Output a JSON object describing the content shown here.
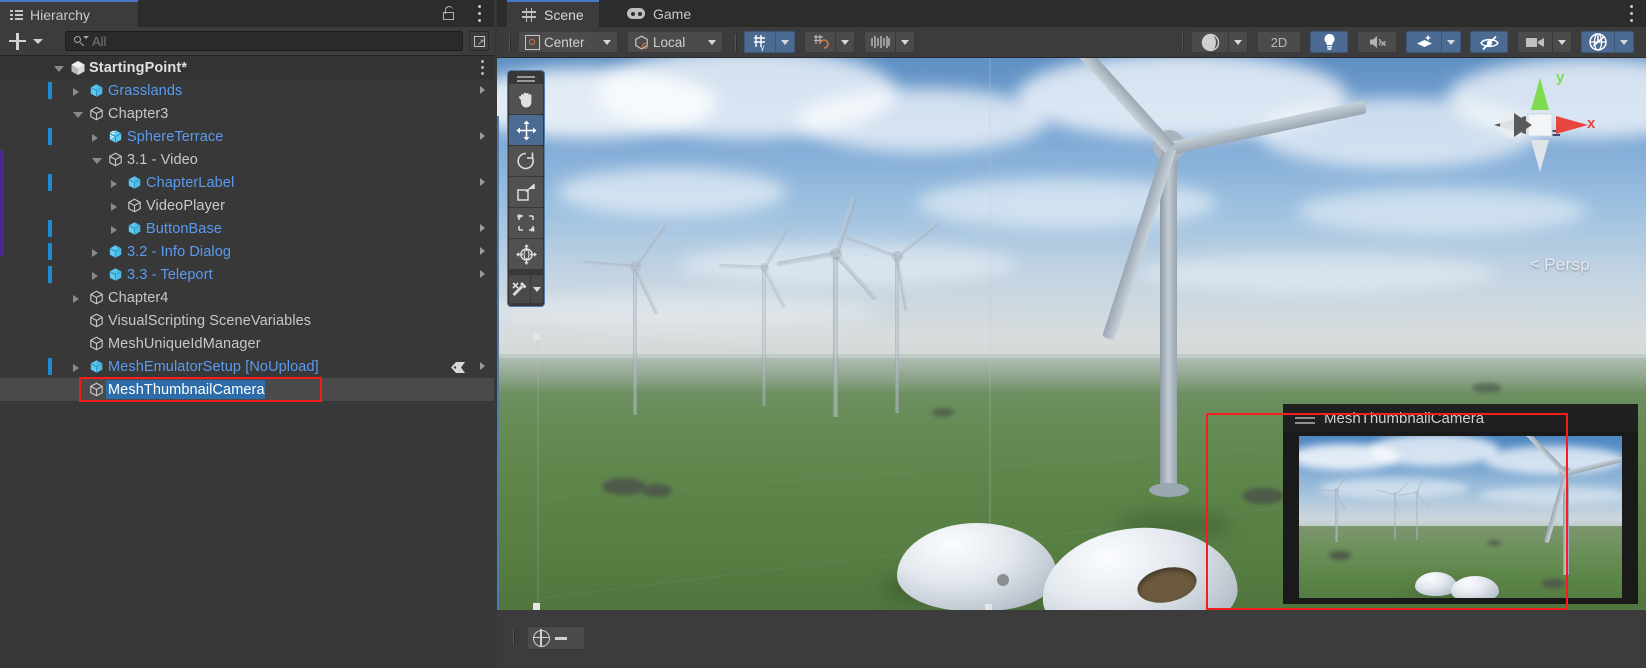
{
  "hierarchy": {
    "tab_label": "Hierarchy",
    "tab_icon": "hierarchy-list-icon",
    "lock_icon": "lock-open-icon",
    "menu_icon": "kebab-menu-icon",
    "create_label": "+",
    "search": {
      "placeholder": "All",
      "icon": "search-icon",
      "value": ""
    },
    "persist_icon": "save-search-icon",
    "tree": [
      {
        "label": "StartingPoint*",
        "depth": 0,
        "icon": "unity-scene-icon",
        "color": "white",
        "bold": true,
        "expanded": true,
        "prefab_bar": false,
        "chevron": false,
        "kebab": true
      },
      {
        "label": "Grasslands",
        "depth": 1,
        "icon": "prefab-cube-icon",
        "color": "blue",
        "bold": false,
        "expanded": false,
        "prefab_bar": true,
        "chevron": true,
        "kebab": false
      },
      {
        "label": "Chapter3",
        "depth": 1,
        "icon": "gameobject-cube-icon",
        "color": "white",
        "bold": false,
        "expanded": true,
        "prefab_bar": false,
        "chevron": false,
        "kebab": false
      },
      {
        "label": "SphereTerrace",
        "depth": 2,
        "icon": "prefab-variant-icon",
        "color": "blue",
        "bold": false,
        "expanded": false,
        "prefab_bar": true,
        "chevron": true,
        "kebab": false
      },
      {
        "label": "3.1 - Video",
        "depth": 2,
        "icon": "gameobject-cube-icon",
        "color": "white",
        "bold": false,
        "expanded": true,
        "prefab_bar": false,
        "chevron": false,
        "kebab": false
      },
      {
        "label": "ChapterLabel",
        "depth": 3,
        "icon": "prefab-cube-icon",
        "color": "blue",
        "bold": false,
        "expanded": false,
        "prefab_bar": true,
        "chevron": true,
        "kebab": false
      },
      {
        "label": "VideoPlayer",
        "depth": 3,
        "icon": "gameobject-cube-icon",
        "color": "white",
        "bold": false,
        "expanded": false,
        "prefab_bar": false,
        "chevron": false,
        "kebab": false
      },
      {
        "label": "ButtonBase",
        "depth": 3,
        "icon": "prefab-cube-icon",
        "color": "blue",
        "bold": false,
        "expanded": false,
        "prefab_bar": true,
        "chevron": true,
        "kebab": false
      },
      {
        "label": "3.2 - Info Dialog",
        "depth": 2,
        "icon": "prefab-cube-icon",
        "color": "blue",
        "bold": false,
        "expanded": false,
        "prefab_bar": true,
        "chevron": true,
        "kebab": false
      },
      {
        "label": "3.3 - Teleport",
        "depth": 2,
        "icon": "prefab-cube-icon",
        "color": "blue",
        "bold": false,
        "expanded": false,
        "prefab_bar": true,
        "chevron": true,
        "kebab": false
      },
      {
        "label": "Chapter4",
        "depth": 1,
        "icon": "gameobject-cube-icon",
        "color": "white",
        "bold": false,
        "expanded": false,
        "prefab_bar": false,
        "chevron": false,
        "kebab": false
      },
      {
        "label": "VisualScripting SceneVariables",
        "depth": 1,
        "icon": "gameobject-cube-icon",
        "color": "white",
        "bold": false,
        "expanded": null,
        "prefab_bar": false,
        "chevron": false,
        "kebab": false
      },
      {
        "label": "MeshUniqueIdManager",
        "depth": 1,
        "icon": "gameobject-cube-icon",
        "color": "white",
        "bold": false,
        "expanded": null,
        "prefab_bar": false,
        "chevron": false,
        "kebab": false
      },
      {
        "label": "MeshEmulatorSetup [NoUpload]",
        "depth": 1,
        "icon": "prefab-cube-icon",
        "color": "blue",
        "bold": false,
        "expanded": false,
        "prefab_bar": true,
        "chevron": true,
        "kebab": false,
        "tag": "tag-icon"
      },
      {
        "label": "MeshThumbnailCamera",
        "depth": 1,
        "icon": "gameobject-cube-icon",
        "color": "white",
        "bold": false,
        "expanded": null,
        "prefab_bar": false,
        "chevron": false,
        "kebab": false,
        "selected": true,
        "renaming": true,
        "annotated": true
      }
    ]
  },
  "scene_panel": {
    "tabs": [
      {
        "label": "Scene",
        "icon": "scene-grid-icon",
        "active": true
      },
      {
        "label": "Game",
        "icon": "gamepad-icon",
        "active": false
      }
    ],
    "menu_icon": "kebab-menu-icon",
    "toolbar": {
      "pivot_label": "Center",
      "pivot_icon": "pivot-center-icon",
      "handle_label": "Local",
      "handle_icon": "handle-local-icon",
      "grid_snap_icon": "grid-axis-y-icon",
      "grid_snap_active": true,
      "snap_increment_icon": "snap-increment-icon",
      "snap_increment_active": false,
      "grid_size_icon": "grid-size-icon",
      "render_mode_icon": "shaded-sphere-icon",
      "twod_label": "2D",
      "lighting_icon": "light-bulb-icon",
      "lighting_active": true,
      "audio_icon": "audio-mute-icon",
      "audio_active": false,
      "fx_icon": "effects-icon",
      "fx_active": true,
      "hidden_icon": "hidden-objects-icon",
      "hidden_active": true,
      "camera_icon": "scene-camera-icon",
      "gizmos_icon": "gizmos-globe-icon",
      "gizmos_active": true
    },
    "tool_palette": {
      "handle_icon": "drag-handle-icon",
      "tools": [
        {
          "icon": "hand-tool-icon",
          "active": false
        },
        {
          "icon": "move-tool-icon",
          "active": true
        },
        {
          "icon": "rotate-tool-icon",
          "active": false
        },
        {
          "icon": "scale-tool-icon",
          "active": false
        },
        {
          "icon": "rect-tool-icon",
          "active": false
        },
        {
          "icon": "transform-tool-icon",
          "active": false
        }
      ],
      "custom_icon": "custom-editor-tool-icon",
      "custom_caret_icon": "chevron-down-icon"
    },
    "gizmo": {
      "axis_y_label": "y",
      "axis_x_label": "x",
      "projection_label": "Persp",
      "axis_y_color": "#7ddb4f",
      "axis_x_color": "#e8453c",
      "axis_z_color": "#4b7fe0",
      "handle_icon": "drag-handle-icon"
    },
    "camera_preview": {
      "title": "MeshThumbnailCamera",
      "handle_icon": "drag-handle-icon",
      "annotated": true
    },
    "bottom_bar": {
      "globe_icon": "grid-visibility-icon",
      "opacity_icon": "grid-opacity-icon"
    }
  },
  "annotation": {
    "color": "#f51d1d",
    "targets": [
      "hierarchy-row-meshthumbnailcamera",
      "scene-camera-preview"
    ]
  }
}
